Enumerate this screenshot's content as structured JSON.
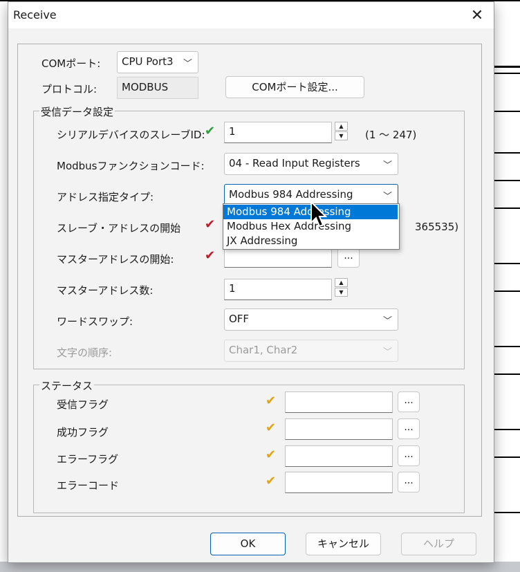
{
  "window": {
    "title": "Receive",
    "close_glyph": "✕"
  },
  "com": {
    "port_label": "COMポート:",
    "port_value": "CPU Port3",
    "protocol_label": "プロトコル:",
    "protocol_value": "MODBUS",
    "settings_button": "COMポート設定..."
  },
  "receive_settings": {
    "group_label": "受信データ設定",
    "slave_id": {
      "label": "シリアルデバイスのスレーブID:",
      "value": "1",
      "range": "(1 ～ 247)"
    },
    "function_code": {
      "label": "Modbusファンクションコード:",
      "value": "04 - Read Input Registers"
    },
    "address_type": {
      "label": "アドレス指定タイプ:",
      "value": "Modbus 984 Addressing"
    },
    "slave_address_start": {
      "label": "スレーブ・アドレスの開始",
      "value": "",
      "range": "365535)"
    },
    "master_address_start": {
      "label": "マスターアドレスの開始:",
      "value": ""
    },
    "master_address_count": {
      "label": "マスターアドレス数:",
      "value": "1"
    },
    "word_swap": {
      "label": "ワードスワップ:",
      "value": "OFF"
    },
    "char_order": {
      "label": "文字の順序:",
      "value": "Char1, Char2"
    }
  },
  "address_type_dropdown": {
    "options": [
      "Modbus 984 Addressing",
      "Modbus Hex Addressing",
      "JX Addressing"
    ],
    "highlighted_index": 0
  },
  "status": {
    "group_label": "ステータス",
    "receive_flag": {
      "label": "受信フラグ",
      "value": ""
    },
    "success_flag": {
      "label": "成功フラグ",
      "value": ""
    },
    "error_flag": {
      "label": "エラーフラグ",
      "value": ""
    },
    "error_code": {
      "label": "エラーコード",
      "value": ""
    }
  },
  "buttons": {
    "ok": "OK",
    "cancel": "キャンセル",
    "help": "ヘルプ",
    "ellipsis": "..."
  },
  "icons": {
    "check": "✔",
    "chevron": "﹀",
    "spin_up": "▲",
    "spin_down": "▼"
  },
  "colors": {
    "accent": "#0078d7",
    "ok_check": "#2e9e3a",
    "error_check": "#c21a2a",
    "status_check": "#e0a417"
  }
}
